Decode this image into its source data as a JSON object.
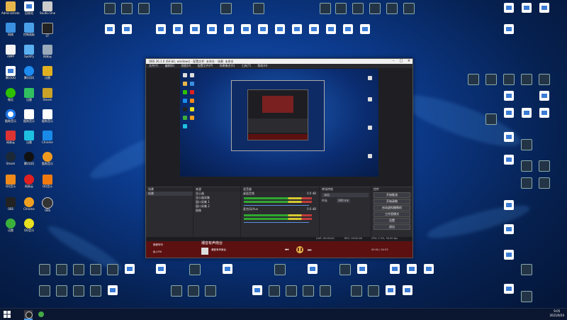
{
  "window": {
    "title": "OBS 26.1.0 (64-bit, windows) - 配置文件: 未命名 - 场景: 未命名",
    "menu": [
      "文件(F)",
      "编辑(E)",
      "视图(V)",
      "配置文件(P)",
      "场景集合(S)",
      "工具(T)",
      "帮助(H)"
    ]
  },
  "docks": {
    "scenes_header": "场景",
    "sources_header": "来源",
    "mixer_header": "混音器",
    "transitions_header": "转场特效",
    "controls_header": "控件",
    "scenes": [
      "场景"
    ],
    "sources": [
      "显示器",
      "显示器采集",
      "窗口采集 1",
      "窗口采集 2",
      "图像"
    ],
    "mixer": [
      {
        "label": "桌面音频",
        "db": "0.0 dB"
      },
      {
        "label": "麦克风/Aux",
        "db": "0.0 dB"
      }
    ],
    "transition_select": "淡出",
    "duration_label": "时长",
    "duration_value": "300 ms",
    "controls": [
      "开始推流",
      "开始录制",
      "启动虚拟摄像机",
      "工作室模式",
      "设置",
      "退出"
    ]
  },
  "status": {
    "live": "LIVE: 00:00:00",
    "rec": "REC: 00:00:00",
    "cpu": "CPU: 2.3%, 30.00 fps"
  },
  "player": {
    "title": "潮音有声南台",
    "left_item1": "随便听听",
    "left_item2": "私人FM",
    "song": "潮音有声南台",
    "time": "00:00 / 04:33"
  },
  "taskbar": {
    "clock_time": "9:05",
    "clock_date": "2021/9/20"
  },
  "desktop_labels": [
    "Administrator",
    "回收站",
    "Studio One",
    "网络",
    "控制面板",
    "CF",
    "AIMP",
    "Spotify",
    "网易云",
    "腾讯QQ",
    "微信",
    "迅雷",
    "Steam",
    "酷狗音乐",
    "OBS",
    "Chrome",
    "QQ音乐"
  ]
}
